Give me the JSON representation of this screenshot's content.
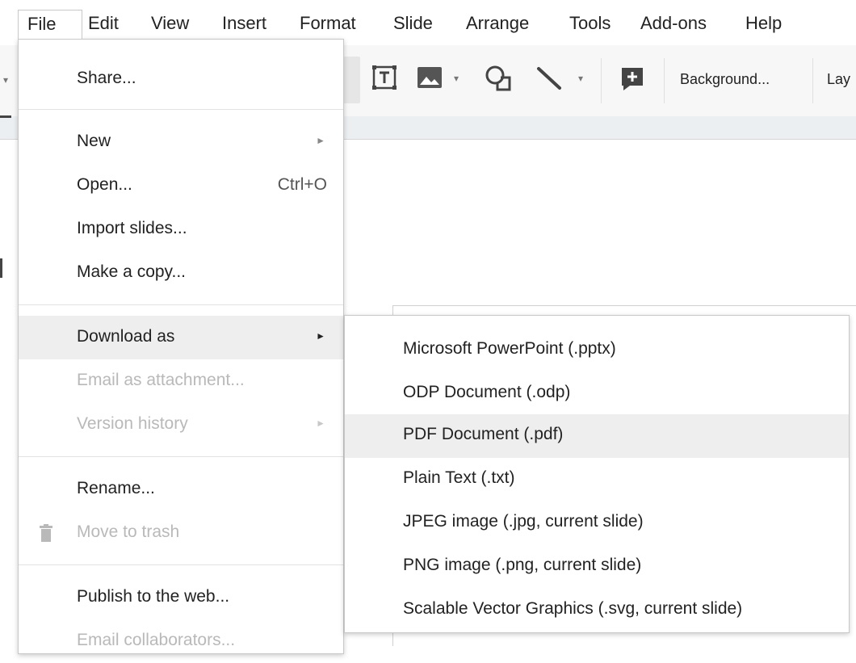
{
  "menubar": {
    "items": [
      "File",
      "Edit",
      "View",
      "Insert",
      "Format",
      "Slide",
      "Arrange",
      "Tools",
      "Add-ons",
      "Help"
    ]
  },
  "toolbar": {
    "background_label": "Background...",
    "layout_label_partial": "Lay"
  },
  "file_menu": {
    "share": "Share...",
    "new": "New",
    "open": "Open...",
    "open_shortcut": "Ctrl+O",
    "import_slides": "Import slides...",
    "make_copy": "Make a copy...",
    "download_as": "Download as",
    "email_attachment": "Email as attachment...",
    "version_history": "Version history",
    "rename": "Rename...",
    "move_to_trash": "Move to trash",
    "publish": "Publish to the web...",
    "email_collaborators": "Email collaborators..."
  },
  "download_submenu": {
    "items": [
      "Microsoft PowerPoint (.pptx)",
      "ODP Document (.odp)",
      "PDF Document (.pdf)",
      "Plain Text (.txt)",
      "JPEG image (.jpg, current slide)",
      "PNG image (.png, current slide)",
      "Scalable Vector Graphics (.svg, current slide)"
    ],
    "highlighted_index": 2
  },
  "icons": {
    "text_box": "text-box-icon",
    "image": "image-icon",
    "shape": "shape-icon",
    "line": "line-icon",
    "comment": "add-comment-icon",
    "trash": "trash-icon",
    "submenu_arrow": "triangle-right-icon"
  },
  "colors": {
    "menu_highlight": "#eeeeee",
    "disabled_text": "#b9b9b9",
    "toolbar_bg": "#f7f7f7"
  }
}
